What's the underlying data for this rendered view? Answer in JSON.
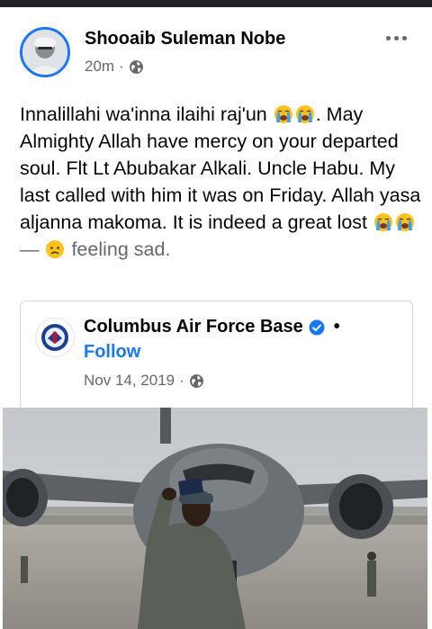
{
  "post": {
    "author": "Shooaib Suleman Nobe",
    "time": "20m",
    "separator": "·",
    "privacy_icon": "globe-icon",
    "more_icon": "more-dots-icon",
    "body": {
      "part1": "Innalillahi wa'inna ilaihi raj'un",
      "part2": ". May Almighty Allah have mercy on your departed soul. Flt Lt Abubakar Alkali. Uncle Habu. My last called with him it was on Friday. Allah yasa aljanna makoma. It is indeed a great lost",
      "dash": " — ",
      "feeling": " feeling sad.",
      "emoji": "loudly-crying-face-icon",
      "feeling_emoji": "sad-face-icon"
    }
  },
  "shared_post": {
    "page_name": "Columbus Air Force Base",
    "verified_icon": "verified-badge-icon",
    "bullet": "•",
    "follow_label": "Follow",
    "date": "Nov 14, 2019",
    "separator": "·",
    "privacy_icon": "globe-icon",
    "photo_description_icon": "aircraft-selfie-photo"
  },
  "colors": {
    "accent": "#1877f2",
    "secondary_text": "#65676b",
    "primary_text": "#050505",
    "border": "#d6d8db"
  }
}
